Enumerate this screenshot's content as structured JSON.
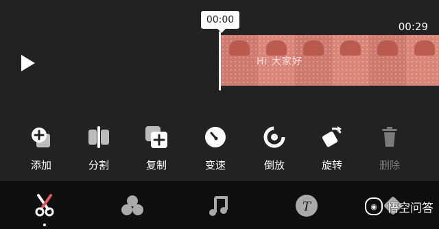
{
  "player": {
    "current_time": "00:00",
    "total_time": "00:29",
    "play_icon": "play-icon",
    "clip_overlay_text": "Hi 大家好"
  },
  "tools": [
    {
      "label": "添加",
      "icon": "add-clip-icon",
      "enabled": true
    },
    {
      "label": "分割",
      "icon": "split-icon",
      "enabled": true
    },
    {
      "label": "复制",
      "icon": "duplicate-icon",
      "enabled": true
    },
    {
      "label": "变速",
      "icon": "speed-icon",
      "enabled": true
    },
    {
      "label": "倒放",
      "icon": "reverse-icon",
      "enabled": true
    },
    {
      "label": "旋转",
      "icon": "rotate-icon",
      "enabled": true
    },
    {
      "label": "删除",
      "icon": "delete-icon",
      "enabled": false
    }
  ],
  "bottom_nav": [
    {
      "icon": "scissors-icon",
      "active": true
    },
    {
      "icon": "filter-icon",
      "active": false
    },
    {
      "icon": "music-icon",
      "active": false
    },
    {
      "icon": "text-icon",
      "active": false
    },
    {
      "icon": "sticker-icon",
      "active": false
    }
  ],
  "watermark": {
    "text": "悟空问答"
  },
  "colors": {
    "background": "#222222",
    "nav_background": "#0f0f0f",
    "clip_tint": "#c86a63",
    "accent_red": "#e25b5b",
    "disabled_text": "#7a7a7a"
  }
}
